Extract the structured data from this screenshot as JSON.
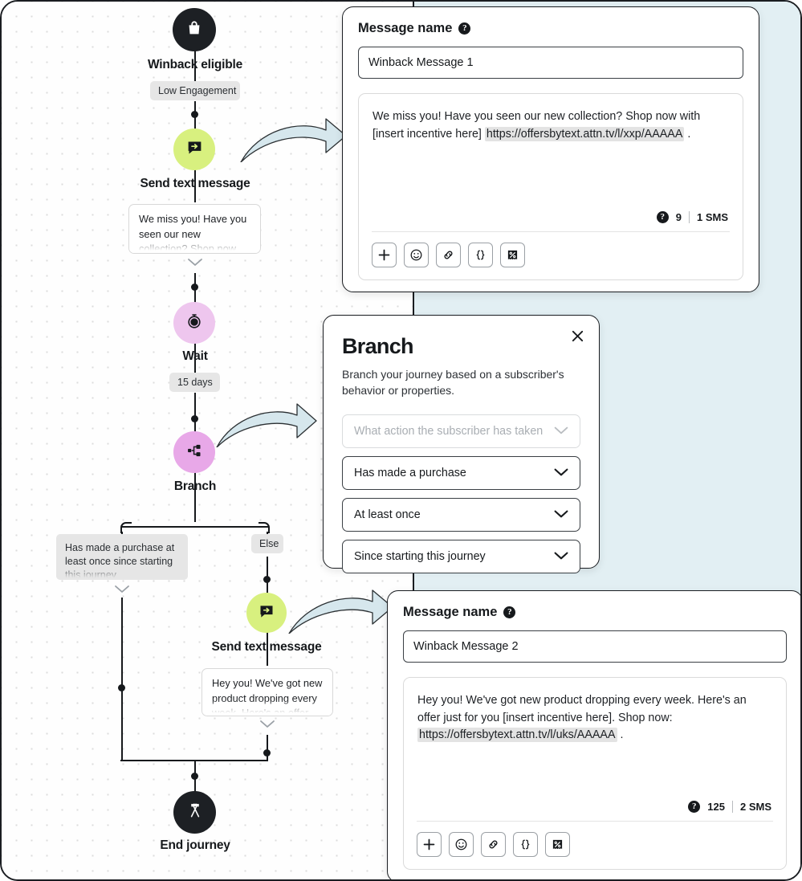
{
  "colors": {
    "teal_panel": "#e2eff3",
    "node_dark": "#1d2024",
    "node_green": "#d8f07f",
    "node_purple_light": "#eec6ee",
    "node_purple": "#e8a8e8",
    "chip_gray": "#e6e6e6",
    "arrow_fill": "#d6e7ed"
  },
  "flow": {
    "nodes": [
      {
        "id": "winback",
        "label": "Winback eligible",
        "icon": "shopping-bag-icon",
        "chip": "Low Engagement"
      },
      {
        "id": "send1",
        "label": "Send text message",
        "icon": "message-send-icon",
        "preview": "We miss you! Have you seen our new collection? Shop now with [insert"
      },
      {
        "id": "wait",
        "label": "Wait",
        "icon": "stopwatch-icon",
        "chip": "15 days"
      },
      {
        "id": "branch",
        "label": "Branch",
        "icon": "branch-icon"
      },
      {
        "id": "send2",
        "label": "Send text message",
        "icon": "message-send-icon",
        "preview": "Hey you! We've got new product dropping every week. Here's an offer just"
      },
      {
        "id": "end",
        "label": "End journey",
        "icon": "crossed-flags-icon"
      }
    ],
    "branch_labels": {
      "yes": "Has made a purchase at least once since starting this journey",
      "else": "Else"
    }
  },
  "message1": {
    "title": "Message name",
    "help_glyph": "?",
    "name_value": "Winback Message 1",
    "name_placeholder": "Message name",
    "body_pre": "We miss you! Have you seen our new collection? Shop now with [insert incentive here] ",
    "body_url": "https://offersbytext.attn.tv/l/xxp/AAAAA",
    "body_post": " .",
    "char_count": "9",
    "sms_count": "1 SMS",
    "tools": [
      {
        "name": "add-icon",
        "label": "+"
      },
      {
        "name": "emoji-icon",
        "label": "☺"
      },
      {
        "name": "link-icon",
        "label": "link"
      },
      {
        "name": "personalization-braces-icon",
        "label": "{}"
      },
      {
        "name": "coupon-percent-icon",
        "label": "%"
      }
    ]
  },
  "branch_panel": {
    "title": "Branch",
    "description": "Branch your journey based on a subscriber's behavior or properties.",
    "close_label": "Close",
    "selects": [
      {
        "name": "branch-action-select",
        "value": "What action the subscriber has taken",
        "is_placeholder": true
      },
      {
        "name": "branch-event-select",
        "value": "Has made a purchase",
        "is_placeholder": false
      },
      {
        "name": "branch-frequency-select",
        "value": "At least once",
        "is_placeholder": false
      },
      {
        "name": "branch-timeframe-select",
        "value": "Since starting this journey",
        "is_placeholder": false
      }
    ]
  },
  "message2": {
    "title": "Message name",
    "help_glyph": "?",
    "name_value": "Winback Message 2",
    "name_placeholder": "Message name",
    "body_pre": "Hey you! We've got new product dropping every week. Here's an offer just for you [insert incentive here]. Shop now: ",
    "body_url": "https://offersbytext.attn.tv/l/uks/AAAAA",
    "body_post": " .",
    "char_count": "125",
    "sms_count": "2 SMS",
    "tools": [
      {
        "name": "add-icon",
        "label": "+"
      },
      {
        "name": "emoji-icon",
        "label": "☺"
      },
      {
        "name": "link-icon",
        "label": "link"
      },
      {
        "name": "personalization-braces-icon",
        "label": "{}"
      },
      {
        "name": "coupon-percent-icon",
        "label": "%"
      }
    ]
  }
}
